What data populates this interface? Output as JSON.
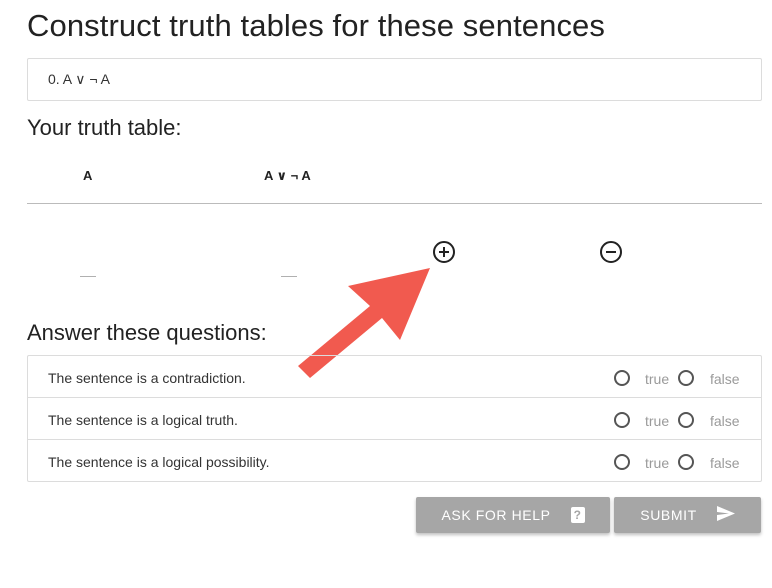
{
  "header": {
    "title": "Construct truth tables for these sentences"
  },
  "sentence": {
    "label": "0. A ∨ ¬ A"
  },
  "truth_table": {
    "title": "Your truth table:",
    "columns": [
      "A",
      "A ∨ ¬ A"
    ],
    "row_cells": [
      "—",
      "—"
    ]
  },
  "questions": {
    "title": "Answer these questions:",
    "items": [
      {
        "text": "The sentence is a contradiction.",
        "true_label": "true",
        "false_label": "false"
      },
      {
        "text": "The sentence is a logical truth.",
        "true_label": "true",
        "false_label": "false"
      },
      {
        "text": "The sentence is a logical possibility.",
        "true_label": "true",
        "false_label": "false"
      }
    ]
  },
  "buttons": {
    "help_label": "ASK FOR HELP",
    "help_icon": "?",
    "submit_label": "SUBMIT"
  },
  "colors": {
    "button_bg": "#a6a6a6",
    "arrow": "#f15a4f",
    "border": "#dcdcdc"
  },
  "icons": {
    "add_row": "plus-circle-icon",
    "remove_row": "minus-circle-icon",
    "help": "question-mark-icon",
    "submit": "send-icon"
  }
}
